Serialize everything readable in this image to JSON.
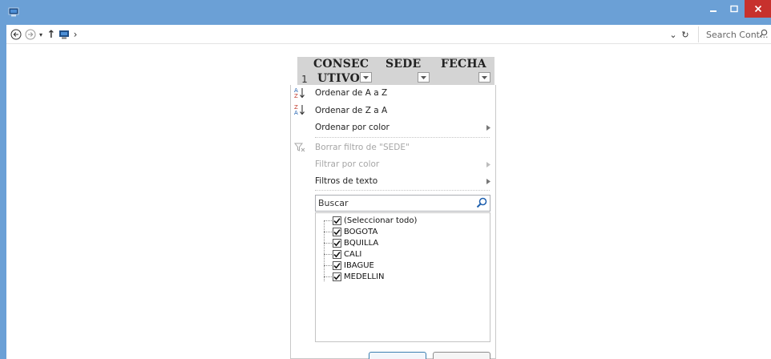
{
  "window": {
    "minimize_glyph": "–",
    "maximize_glyph": "□",
    "close_glyph": "×"
  },
  "nav": {
    "back_glyph": "←",
    "forward_glyph": "→",
    "recent_glyph": "▾",
    "up_glyph": "↑",
    "breadcrumb_arrow": "›",
    "dropdown_glyph": "⌄",
    "refresh_glyph": "↻",
    "search_placeholder": "Search Cont..."
  },
  "sheet": {
    "row_number": "1",
    "headers": {
      "consecutivo_line1": "CONSEC",
      "consecutivo_line2": "UTIVO",
      "sede": "SEDE",
      "fecha": "FECHA"
    }
  },
  "filter_menu": {
    "sort_az": "Ordenar de A a Z",
    "sort_za": "Ordenar de Z a A",
    "sort_color": "Ordenar por color",
    "clear_filter": "Borrar filtro de \"SEDE\"",
    "filter_color": "Filtrar por color",
    "text_filters": "Filtros de texto",
    "submenu_arrow": "›",
    "search_placeholder": "Buscar",
    "items": [
      {
        "label": "(Seleccionar todo)",
        "checked": true
      },
      {
        "label": "BOGOTA",
        "checked": true
      },
      {
        "label": "BQUILLA",
        "checked": true
      },
      {
        "label": "CALI",
        "checked": true
      },
      {
        "label": "IBAGUE",
        "checked": true
      },
      {
        "label": "MEDELLIN",
        "checked": true
      }
    ]
  },
  "colors": {
    "title_bar": "#6ba0d6",
    "close_button": "#c7312d",
    "header_fill": "#d4d4d4"
  }
}
